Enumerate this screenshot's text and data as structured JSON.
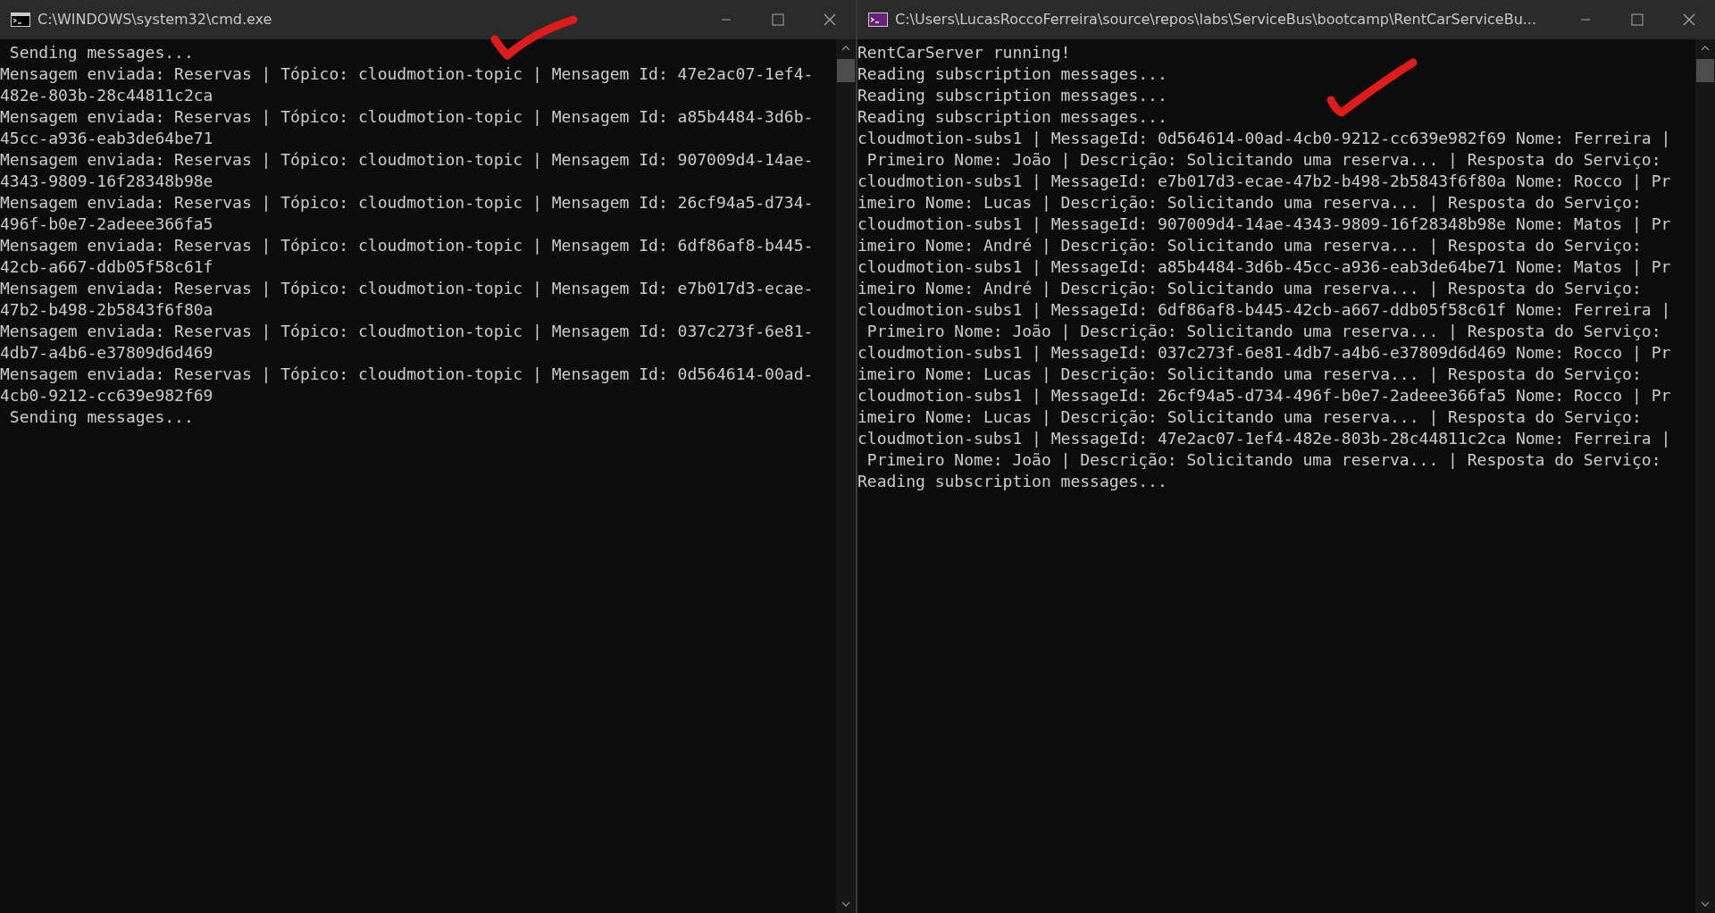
{
  "windows": [
    {
      "title": "C:\\WINDOWS\\system32\\cmd.exe",
      "kind": "cmd",
      "lines": [
        " Sending messages...",
        "Mensagem enviada: Reservas | Tópico: cloudmotion-topic | Mensagem Id: 47e2ac07-1ef4-",
        "482e-803b-28c44811c2ca",
        "Mensagem enviada: Reservas | Tópico: cloudmotion-topic | Mensagem Id: a85b4484-3d6b-",
        "45cc-a936-eab3de64be71",
        "Mensagem enviada: Reservas | Tópico: cloudmotion-topic | Mensagem Id: 907009d4-14ae-",
        "4343-9809-16f28348b98e",
        "Mensagem enviada: Reservas | Tópico: cloudmotion-topic | Mensagem Id: 26cf94a5-d734-",
        "496f-b0e7-2adeee366fa5",
        "Mensagem enviada: Reservas | Tópico: cloudmotion-topic | Mensagem Id: 6df86af8-b445-",
        "42cb-a667-ddb05f58c61f",
        "Mensagem enviada: Reservas | Tópico: cloudmotion-topic | Mensagem Id: e7b017d3-ecae-",
        "47b2-b498-2b5843f6f80a",
        "Mensagem enviada: Reservas | Tópico: cloudmotion-topic | Mensagem Id: 037c273f-6e81-",
        "4db7-a4b6-e37809d6d469",
        "Mensagem enviada: Reservas | Tópico: cloudmotion-topic | Mensagem Id: 0d564614-00ad-",
        "4cb0-9212-cc639e982f69",
        " Sending messages..."
      ]
    },
    {
      "title": "C:\\Users\\LucasRoccoFerreira\\source\\repos\\labs\\ServiceBus\\bootcamp\\RentCarServiceBu...",
      "kind": "vs",
      "lines": [
        "RentCarServer running!",
        "Reading subscription messages...",
        "Reading subscription messages...",
        "Reading subscription messages...",
        "cloudmotion-subs1 | MessageId: 0d564614-00ad-4cb0-9212-cc639e982f69 Nome: Ferreira |",
        " Primeiro Nome: João | Descrição: Solicitando uma reserva... | Resposta do Serviço:",
        "cloudmotion-subs1 | MessageId: e7b017d3-ecae-47b2-b498-2b5843f6f80a Nome: Rocco | Pr",
        "imeiro Nome: Lucas | Descrição: Solicitando uma reserva... | Resposta do Serviço:",
        "cloudmotion-subs1 | MessageId: 907009d4-14ae-4343-9809-16f28348b98e Nome: Matos | Pr",
        "imeiro Nome: André | Descrição: Solicitando uma reserva... | Resposta do Serviço:",
        "cloudmotion-subs1 | MessageId: a85b4484-3d6b-45cc-a936-eab3de64be71 Nome: Matos | Pr",
        "imeiro Nome: André | Descrição: Solicitando uma reserva... | Resposta do Serviço:",
        "cloudmotion-subs1 | MessageId: 6df86af8-b445-42cb-a667-ddb05f58c61f Nome: Ferreira |",
        " Primeiro Nome: João | Descrição: Solicitando uma reserva... | Resposta do Serviço:",
        "cloudmotion-subs1 | MessageId: 037c273f-6e81-4db7-a4b6-e37809d6d469 Nome: Rocco | Pr",
        "imeiro Nome: Lucas | Descrição: Solicitando uma reserva... | Resposta do Serviço:",
        "cloudmotion-subs1 | MessageId: 26cf94a5-d734-496f-b0e7-2adeee366fa5 Nome: Rocco | Pr",
        "imeiro Nome: Lucas | Descrição: Solicitando uma reserva... | Resposta do Serviço:",
        "cloudmotion-subs1 | MessageId: 47e2ac07-1ef4-482e-803b-28c44811c2ca Nome: Ferreira |",
        " Primeiro Nome: João | Descrição: Solicitando uma reserva... | Resposta do Serviço:",
        "Reading subscription messages..."
      ]
    }
  ]
}
